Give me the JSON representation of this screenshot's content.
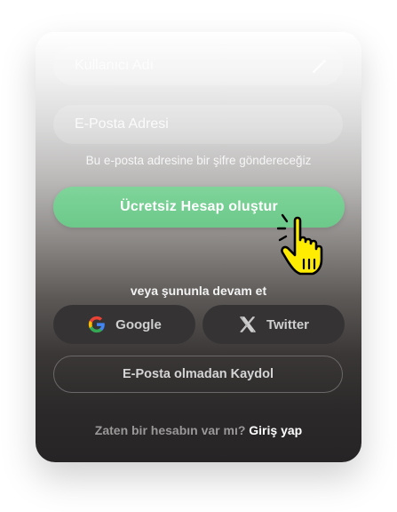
{
  "form": {
    "username_placeholder": "Kullanıcı Adı",
    "email_placeholder": "E-Posta Adresi",
    "email_hint": "Bu e-posta adresine bir şifre göndereceğiz"
  },
  "cta": {
    "label": "Ücretsiz Hesap oluştur"
  },
  "social": {
    "divider": "veya şununla devam et",
    "google_label": "Google",
    "twitter_label": "Twitter"
  },
  "no_email": {
    "label": "E-Posta olmadan Kaydol"
  },
  "login": {
    "prompt": "Zaten bir hesabın var mı?",
    "link": "Giriş yap"
  },
  "colors": {
    "accent_green": "#6cc98a",
    "card_dark": "#262425",
    "cursor_yellow": "#ffec00"
  },
  "icons": [
    "magic-wand-icon",
    "google-icon",
    "x-twitter-icon",
    "hand-pointer-cursor-icon"
  ]
}
